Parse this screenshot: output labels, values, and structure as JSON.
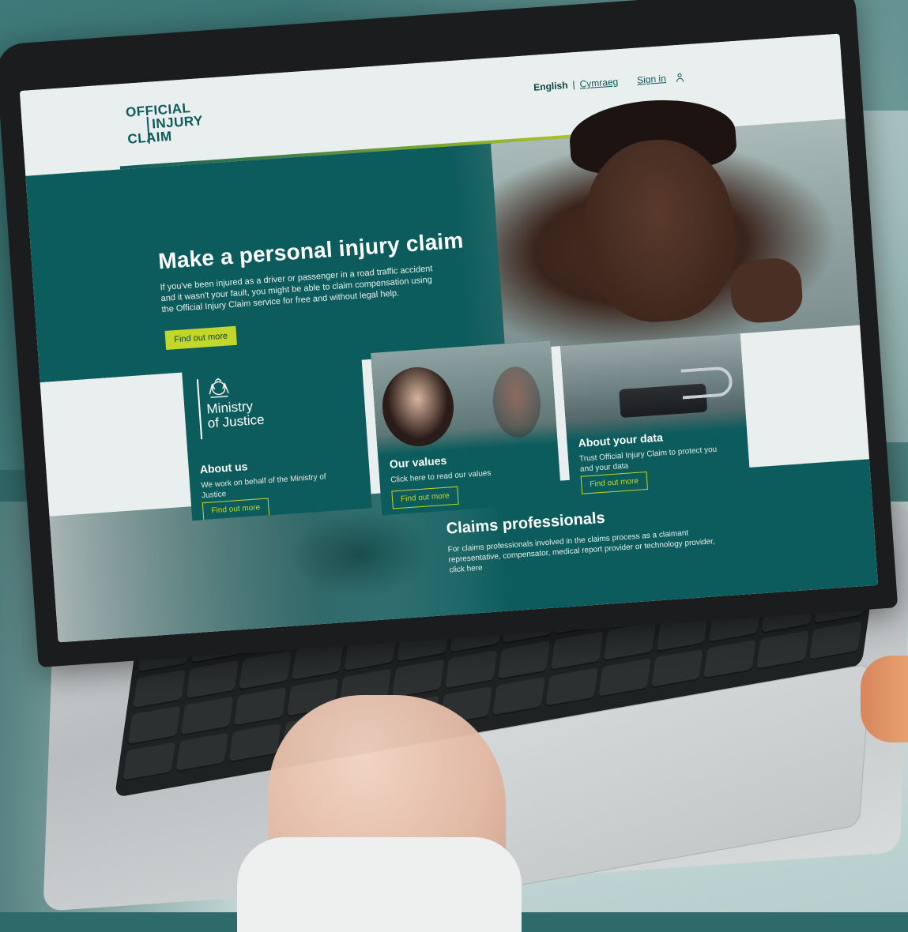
{
  "site": {
    "logo_lines": [
      "OFFICIAL",
      "INJURY",
      "CLAIM"
    ],
    "language_current": "English",
    "language_separator": "|",
    "language_alt": "Cymraeg",
    "sign_in": "Sign in",
    "icons": {
      "account": "user-icon"
    }
  },
  "hero": {
    "title": "Make a personal injury claim",
    "lede": "If you've been injured as a driver or passenger in a road traffic accident and it wasn't your fault, you might be able to claim compensation using the Official Injury Claim service for free and without legal help.",
    "cta": "Find out more"
  },
  "cards": [
    {
      "brand_lines": [
        "Ministry",
        "of Justice"
      ],
      "title": "About us",
      "text": "We work on behalf of the Ministry of Justice",
      "cta": "Find out more"
    },
    {
      "title": "Our values",
      "text": "Click here to read our values",
      "cta": "Find out more"
    },
    {
      "title": "About your data",
      "text": "Trust Official Injury Claim to protect you and your data",
      "cta": "Find out more"
    }
  ],
  "professionals": {
    "title": "Claims professionals",
    "text": "For claims professionals involved in the claims process as a claimant representative, compensator, medical report provider or technology provider, click here"
  },
  "colors": {
    "brand_teal": "#0d5c5d",
    "accent_lime": "#c2d72a",
    "header_bg": "#e9efee"
  }
}
